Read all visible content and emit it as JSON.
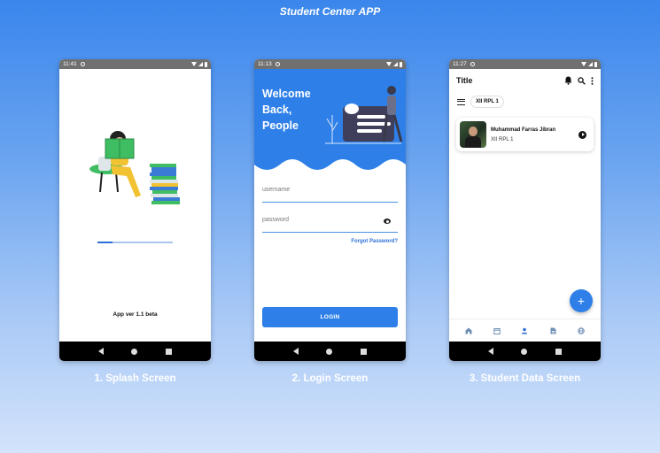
{
  "page": {
    "title": "Student Center APP"
  },
  "colors": {
    "accent": "#2e80e8",
    "dark_accent": "#2d6fd8",
    "statusbar": "#707070",
    "navbar": "#000000"
  },
  "screens": [
    {
      "caption": "1. Splash Screen",
      "status_time": "11:41",
      "version_text": "App ver 1.1 beta",
      "loading_progress": 0.2
    },
    {
      "caption": "2. Login Screen",
      "status_time": "11:13",
      "welcome_line1": "Welcome",
      "welcome_line2": "Back,",
      "welcome_line3": "People",
      "username_placeholder": "username",
      "password_placeholder": "password",
      "forgot_password": "Forgot Password?",
      "login_button": "LOGIN"
    },
    {
      "caption": "3. Student Data Screen",
      "status_time": "11:27",
      "title": "Title",
      "class_chip": "XII RPL 1",
      "students": [
        {
          "name": "Muhammad Farras Jibran",
          "class": "XII RPL 1"
        }
      ],
      "fab_label": "+",
      "bottom_nav": [
        "home-icon",
        "calendar-icon",
        "person-icon",
        "document-icon",
        "globe-icon"
      ]
    }
  ]
}
